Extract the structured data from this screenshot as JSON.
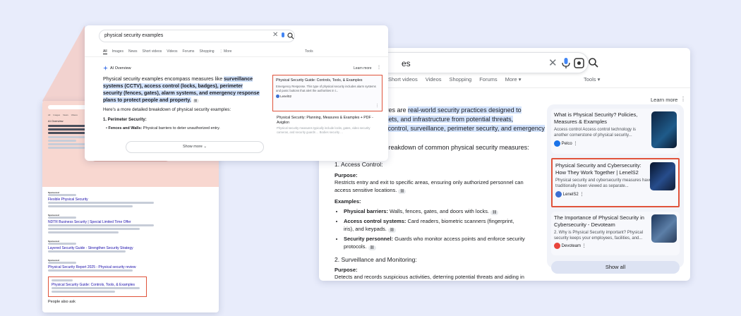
{
  "colors": {
    "accent": "#1a0dab",
    "highlight": "#d3e3fd",
    "red_box": "#e0533b",
    "bg": "#e8ecfb"
  },
  "small_page": {
    "ai_overview_label": "AI Overview",
    "show_more": "Show more",
    "ads": [
      {
        "sponsored": "Sponsored",
        "title": "Flexible Physical Security"
      },
      {
        "sponsored": "Sponsored",
        "title": "NDTR Business Security | Special Limited Time Offer"
      },
      {
        "sponsored": "Sponsored",
        "title": "Layered Security Guide - Strengthen Security Strategy"
      },
      {
        "sponsored": "Sponsored",
        "title": "Physical Security Report 2025 - Physical security review"
      }
    ],
    "highlighted_result_title": "Physical Security Guide: Controls, Tools, & Examples",
    "people_also_ask": "People also ask"
  },
  "zoom": {
    "query": "physical security examples",
    "tabs": [
      "All",
      "Images",
      "News",
      "Short videos",
      "Videos",
      "Forums",
      "Shopping",
      "⋮ More"
    ],
    "tools": "Tools",
    "ai_overview": "AI Overview",
    "learn_more": "Learn more",
    "p1_plain_a": "Physical security examples encompass measures like ",
    "p1_hl": "surveillance systems (CCTV), access control (locks, badges), perimeter security (fences, gates), alarm systems, and emergency response plans to protect people and property.",
    "p2": "Here's a more detailed breakdown of physical security examples:",
    "h1": "1. Perimeter Security:",
    "b1_strong": "Fences and Walls:",
    "b1_text": " Physical barriers to deter unauthorized entry.",
    "show_more": "Show more",
    "cards": [
      {
        "title": "Physical Security Guide: Controls, Tools, & Examples",
        "snippet": "Emergency Response. This type of physical security includes alarm systems and panic buttons that alert the authorities in t...",
        "source": "LenelS2"
      },
      {
        "title": "Physical Security: Planning, Measures & Examples + PDF - Avigilon",
        "snippet": "Physical security measures typically include locks, gates, video security cameras, and security guards ... Bodies security ...",
        "source": ""
      }
    ]
  },
  "big": {
    "query_tail": "es",
    "tabs": [
      "Short videos",
      "Videos",
      "Shopping",
      "Forums",
      "More ▾"
    ],
    "tools": "Tools ▾",
    "learn_more": "Learn more",
    "p1_a": "sures are ",
    "p1_hl_a": "real-world security practices designed to",
    "p1_hl_b": "sets, and infrastructure from potential threats,",
    "p1_hl_c": "ss control, surveillance, perimeter security, and emergency",
    "p2": "d breakdown of common physical security measures:",
    "s1_title": "1. Access Control:",
    "purpose_label": "Purpose:",
    "s1_purpose": "Restricts entry and exit to specific areas, ensuring only authorized personnel can access sensitive locations.",
    "examples_label": "Examples:",
    "bullets": [
      {
        "strong": "Physical barriers:",
        "text": " Walls, fences, gates, and doors with locks."
      },
      {
        "strong": "Access control systems:",
        "text": " Card readers, biometric scanners (fingerprint, iris), and keypads."
      },
      {
        "strong": "Security personnel:",
        "text": " Guards who monitor access points and enforce security protocols."
      }
    ],
    "s2_title": "2. Surveillance and Monitoring:",
    "s2_purpose_label": "Purpose:",
    "s2_purpose": "Detects and records suspicious activities, deterring potential threats and aiding in",
    "side": [
      {
        "title": "What is Physical Security? Policies, Measures & Examples",
        "snippet": "Access control Access control technology is another cornerstone of physical security...",
        "source": "Pelco"
      },
      {
        "title": "Physical Security and Cybersecurity: How They Work Together | LenelS2",
        "snippet": "Physical security and cybersecurity measures have traditionally been viewed as separate...",
        "source": "LenelS2"
      },
      {
        "title": "The Importance of Physical Security in Cybersecurity - Devoteam",
        "snippet": "2. Why is Physical Security important? Physical security keeps your employees, facilities, and...",
        "source": "Devoteam"
      }
    ],
    "show_all": "Show all"
  }
}
